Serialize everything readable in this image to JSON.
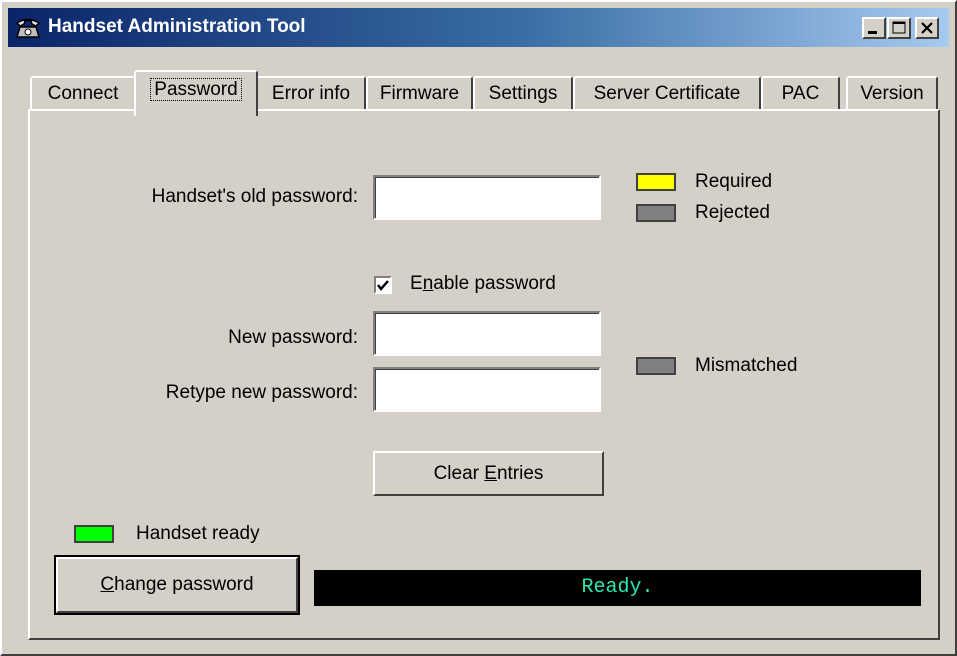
{
  "window": {
    "title": "Handset Administration Tool",
    "icon": "telephone-handset-icon"
  },
  "title_buttons": [
    "minimize-icon",
    "maximize-icon",
    "close-icon"
  ],
  "tabs": [
    {
      "label": "Connect"
    },
    {
      "label": "Password",
      "active": true
    },
    {
      "label": "Error info"
    },
    {
      "label": "Firmware"
    },
    {
      "label": "Settings"
    },
    {
      "label": "Server Certificate"
    },
    {
      "label": "PAC"
    },
    {
      "label": "Version"
    }
  ],
  "form": {
    "old_password_label": "Handset's old password:",
    "old_password_value": "",
    "enable_password_label": "Enable password",
    "enable_password_mnemonic": "n",
    "enable_password_checked": true,
    "new_password_label": "New password:",
    "new_password_value": "",
    "retype_password_label": "Retype new password:",
    "retype_password_value": "",
    "clear_button_label": "Clear Entries",
    "clear_button_mnemonic": "E"
  },
  "legend": {
    "required": {
      "label": "Required",
      "color": "#ffff00"
    },
    "rejected": {
      "label": "Rejected",
      "color": "#808080"
    },
    "mismatched": {
      "label": "Mismatched",
      "color": "#808080"
    }
  },
  "status": {
    "handset_ready_label": "Handset ready",
    "handset_ready_color": "#00ff00",
    "change_button_label": "Change password",
    "change_button_mnemonic": "C",
    "message": "Ready.",
    "message_color": "#2ee6b0"
  }
}
